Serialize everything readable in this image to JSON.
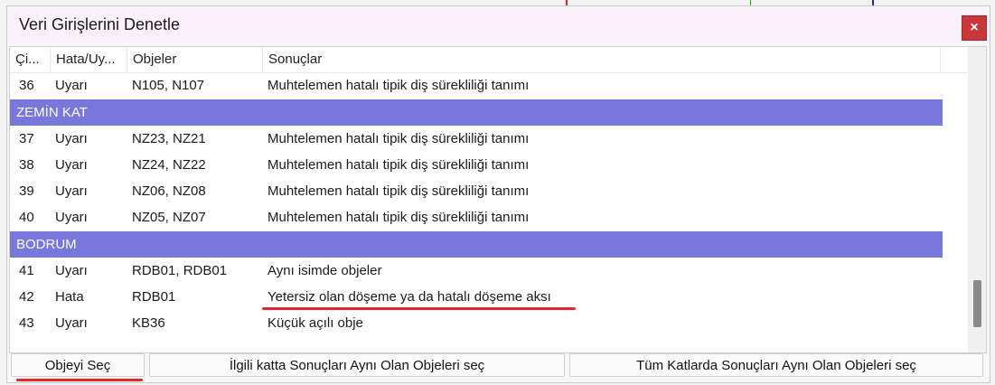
{
  "dialog": {
    "title": "Veri Girişlerini Denetle",
    "close_label": "×"
  },
  "table": {
    "columns": [
      "Çi...",
      "Hata/Uy...",
      "Objeler",
      "Sonuçlar"
    ],
    "rows": [
      {
        "type": "data",
        "no": "36",
        "kind": "Uyarı",
        "objects": "N105, N107",
        "result": "Muhtelemen hatalı tipik diş sürekliliği tanımı"
      },
      {
        "type": "group",
        "label": "ZEMİN KAT"
      },
      {
        "type": "data",
        "no": "37",
        "kind": "Uyarı",
        "objects": "NZ23, NZ21",
        "result": "Muhtelemen hatalı tipik diş sürekliliği tanımı"
      },
      {
        "type": "data",
        "no": "38",
        "kind": "Uyarı",
        "objects": "NZ24, NZ22",
        "result": "Muhtelemen hatalı tipik diş sürekliliği tanımı"
      },
      {
        "type": "data",
        "no": "39",
        "kind": "Uyarı",
        "objects": "NZ06, NZ08",
        "result": "Muhtelemen hatalı tipik diş sürekliliği tanımı"
      },
      {
        "type": "data",
        "no": "40",
        "kind": "Uyarı",
        "objects": "NZ05, NZ07",
        "result": "Muhtelemen hatalı tipik diş sürekliliği tanımı"
      },
      {
        "type": "group",
        "label": "BODRUM"
      },
      {
        "type": "data",
        "no": "41",
        "kind": "Uyarı",
        "objects": "RDB01, RDB01",
        "result": "Aynı isimde objeler"
      },
      {
        "type": "data",
        "no": "42",
        "kind": "Hata",
        "objects": "RDB01",
        "result": "Yetersiz olan döşeme ya da hatalı döşeme aksı"
      },
      {
        "type": "data",
        "no": "43",
        "kind": "Uyarı",
        "objects": "KB36",
        "result": "Küçük açılı obje"
      }
    ]
  },
  "buttons": {
    "select_object": "Objeyi Seç",
    "select_same_floor": "İlgili katta Sonuçları Aynı Olan Objeleri seç",
    "select_all_floors": "Tüm Katlarda Sonuçları Aynı Olan Objeleri seç"
  },
  "colors": {
    "group_row": "#7878dc",
    "highlight_underline": "#e8242b",
    "close_button": "#c8383a"
  }
}
